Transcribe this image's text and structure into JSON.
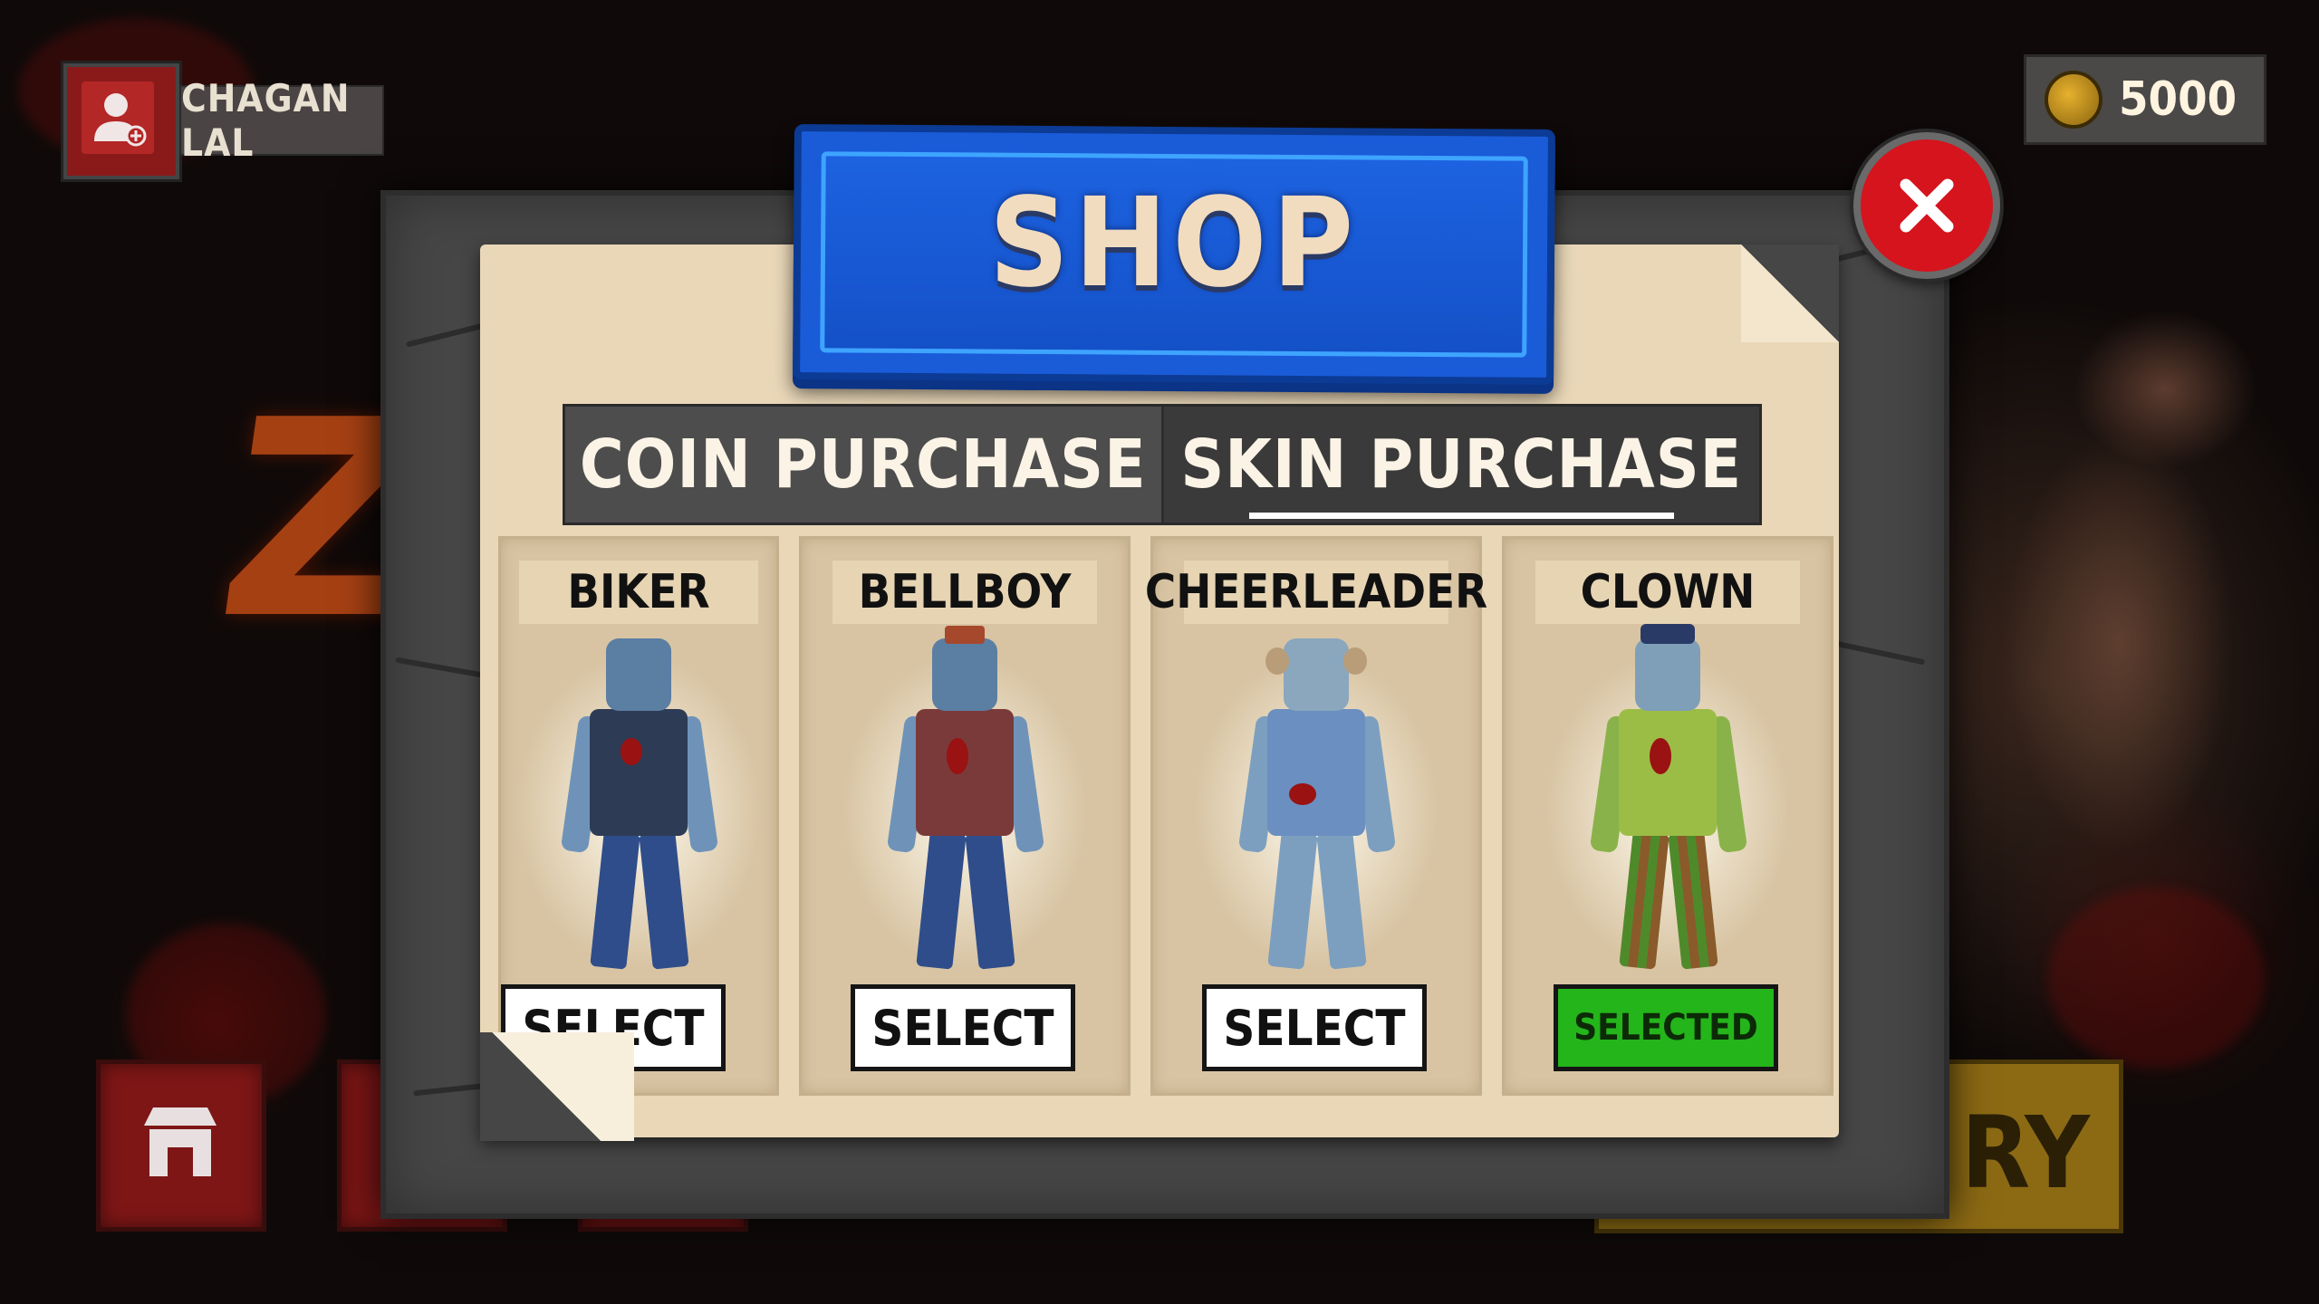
{
  "player": {
    "name": "CHAGAN LAL"
  },
  "wallet": {
    "coins": "5000",
    "coin_icon": "coin-icon"
  },
  "shop": {
    "title": "SHOP",
    "tabs": [
      {
        "label": "COIN PURCHASE",
        "active": false
      },
      {
        "label": "SKIN PURCHASE",
        "active": true
      }
    ],
    "skins": [
      {
        "name": "BIKER",
        "button": "SELECT",
        "selected": false
      },
      {
        "name": "BELLBOY",
        "button": "SELECT",
        "selected": false
      },
      {
        "name": "CHEERLEADER",
        "button": "SELECT",
        "selected": false
      },
      {
        "name": "CLOWN",
        "button": "SELECTED",
        "selected": true
      }
    ]
  },
  "background": {
    "logo_letter": "Z",
    "partial_button_text": "RY"
  },
  "colors": {
    "accent_blue": "#1a5bd8",
    "close_red": "#d5141d",
    "selected_green": "#24b51a",
    "paper": "#e9d7b8"
  }
}
